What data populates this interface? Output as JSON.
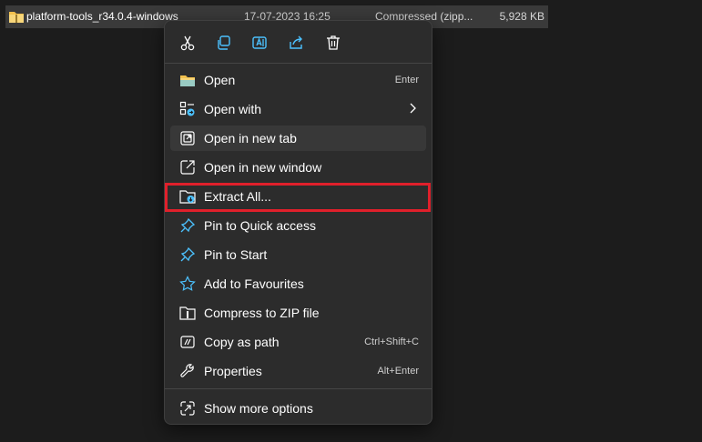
{
  "file_row": {
    "name": "platform-tools_r34.0.4-windows",
    "date": "17-07-2023 16:25",
    "type": "Compressed (zipp...",
    "size": "5,928 KB",
    "icon": "zip-folder-icon"
  },
  "quick_actions": [
    {
      "name": "cut",
      "icon": "scissors-icon"
    },
    {
      "name": "copy",
      "icon": "copy-icon"
    },
    {
      "name": "rename",
      "icon": "rename-icon"
    },
    {
      "name": "share",
      "icon": "share-icon"
    },
    {
      "name": "delete",
      "icon": "trash-icon"
    }
  ],
  "menu": {
    "items": [
      {
        "label": "Open",
        "shortcut": "Enter",
        "icon": "folder-icon"
      },
      {
        "label": "Open with",
        "shortcut": "",
        "icon": "open-with-icon",
        "submenu": true
      },
      {
        "label": "Open in new tab",
        "shortcut": "",
        "icon": "new-tab-icon",
        "hovered": true
      },
      {
        "label": "Open in new window",
        "shortcut": "",
        "icon": "new-window-icon"
      },
      {
        "label": "Extract All...",
        "shortcut": "",
        "icon": "extract-icon",
        "highlighted": true
      },
      {
        "label": "Pin to Quick access",
        "shortcut": "",
        "icon": "pin-icon"
      },
      {
        "label": "Pin to Start",
        "shortcut": "",
        "icon": "pin-icon"
      },
      {
        "label": "Add to Favourites",
        "shortcut": "",
        "icon": "star-icon"
      },
      {
        "label": "Compress to ZIP file",
        "shortcut": "",
        "icon": "zip-icon"
      },
      {
        "label": "Copy as path",
        "shortcut": "Ctrl+Shift+C",
        "icon": "copy-path-icon"
      },
      {
        "label": "Properties",
        "shortcut": "Alt+Enter",
        "icon": "wrench-icon"
      },
      {
        "label": "Show more options",
        "shortcut": "",
        "icon": "more-options-icon"
      }
    ]
  },
  "colors": {
    "background": "#1c1c1c",
    "menu_bg": "#2c2c2c",
    "accent_blue": "#4cc2ff",
    "highlight_red": "#e0202b",
    "folder_yellow": "#f2c14e"
  }
}
